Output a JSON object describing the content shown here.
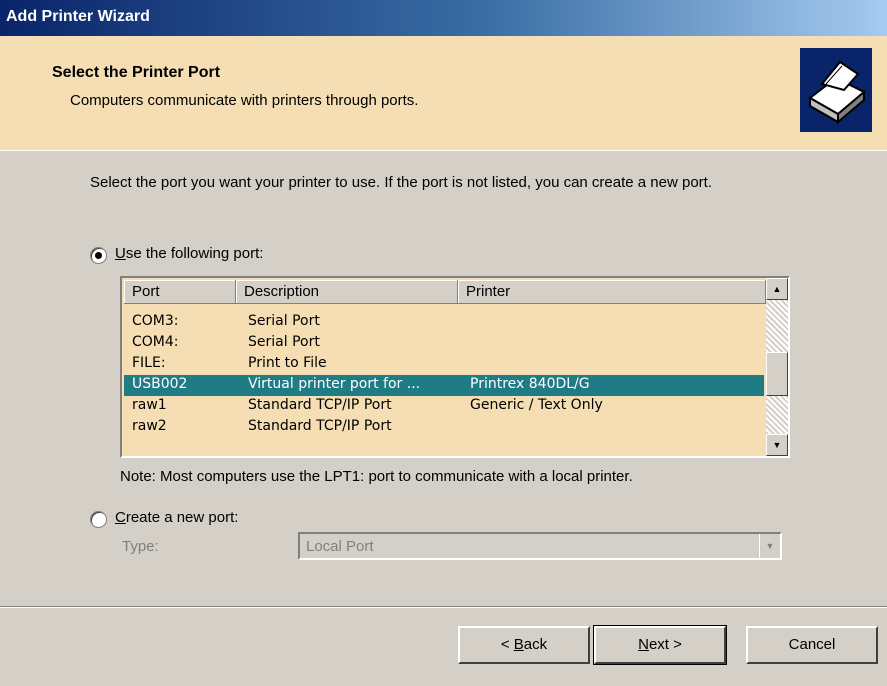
{
  "window": {
    "title": "Add Printer Wizard"
  },
  "header": {
    "title": "Select the Printer Port",
    "subtitle": "Computers communicate with printers through ports.",
    "icon": "printer-icon"
  },
  "intro_text": "Select the port you want your printer to use.  If the port is not listed, you can create a new port.",
  "use_port": {
    "label_prefix": "",
    "label_accel": "U",
    "label_rest": "se the following port:",
    "checked": true
  },
  "ports_table": {
    "columns": [
      "Port",
      "Description",
      "Printer"
    ],
    "rows": [
      {
        "port": "COM3:",
        "description": "Serial Port",
        "printer": ""
      },
      {
        "port": "COM4:",
        "description": "Serial Port",
        "printer": ""
      },
      {
        "port": "FILE:",
        "description": "Print to File",
        "printer": ""
      },
      {
        "port": "USB002",
        "description": "Virtual printer port for ...",
        "printer": "Printrex 840DL/G",
        "selected": true
      },
      {
        "port": "raw1",
        "description": "Standard TCP/IP Port",
        "printer": "Generic / Text Only"
      },
      {
        "port": "raw2",
        "description": "Standard TCP/IP Port",
        "printer": ""
      }
    ]
  },
  "note": "Note: Most computers use the LPT1: port to communicate with a local printer.",
  "create_port": {
    "label_accel": "C",
    "label_rest": "reate a new port:",
    "checked": false
  },
  "type_field": {
    "label": "Type:",
    "value": "Local Port"
  },
  "buttons": {
    "back_prefix": "< ",
    "back_accel": "B",
    "back_rest": "ack",
    "next_accel": "N",
    "next_rest": "ext >",
    "cancel": "Cancel"
  },
  "colors": {
    "header_bg": "#f5deb3",
    "selection": "#1f7b84",
    "title_bar": "#0a246a"
  }
}
